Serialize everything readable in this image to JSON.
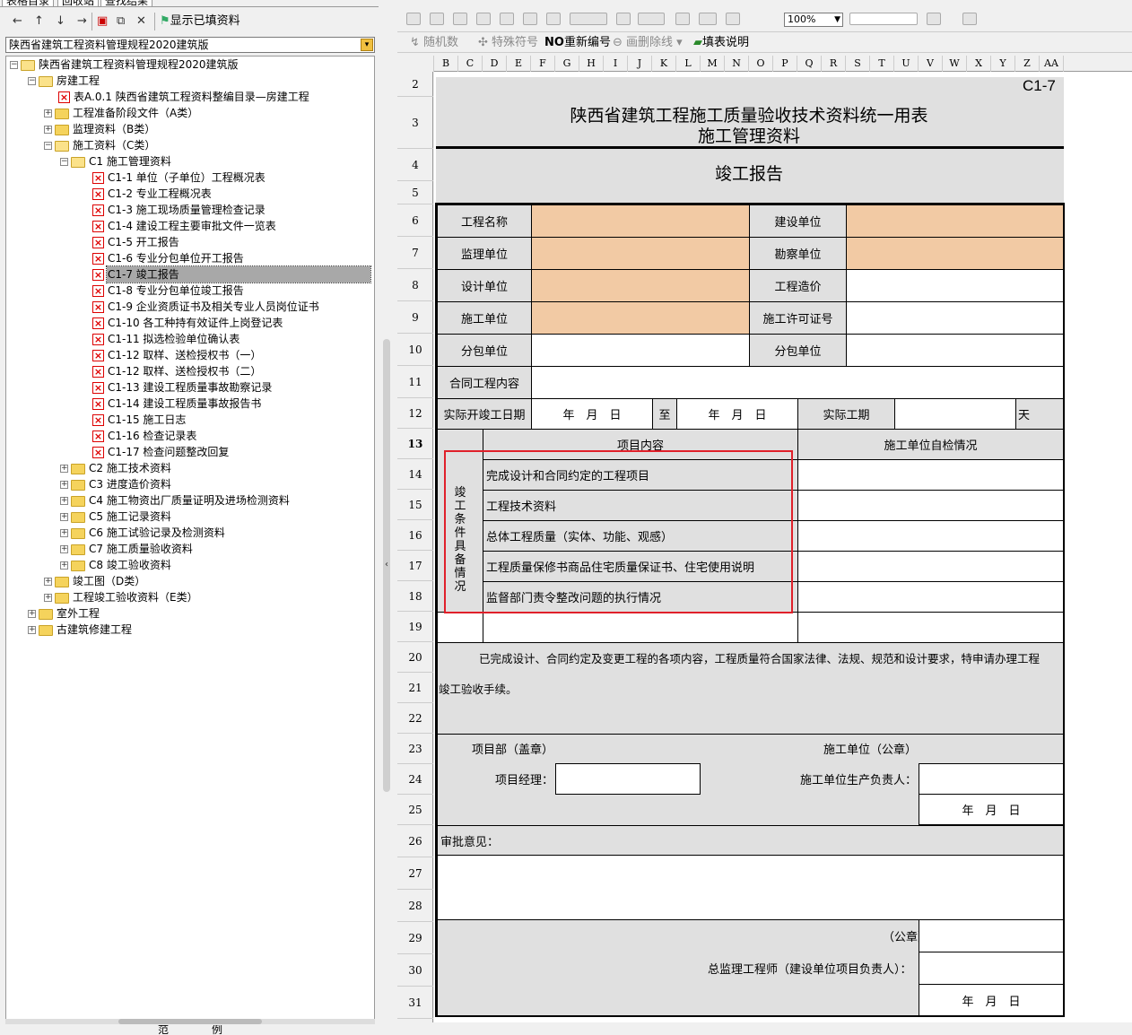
{
  "left_panel": {
    "tabs": [
      "表格目录",
      "回收站",
      "查找结果"
    ],
    "toolbar": {
      "show_filled": "显示已填资料"
    },
    "spec_select": "陕西省建筑工程资料管理规程2020建筑版",
    "tree": [
      {
        "label": "陕西省建筑工程资料管理规程2020建筑版"
      },
      {
        "label": "房建工程"
      },
      {
        "label": "表A.0.1 陕西省建筑工程资料整编目录—房建工程"
      },
      {
        "label": "工程准备阶段文件（A类）"
      },
      {
        "label": "监理资料（B类）"
      },
      {
        "label": "施工资料（C类）"
      },
      {
        "label": "C1 施工管理资料"
      },
      {
        "label": "C1-1 单位（子单位）工程概况表"
      },
      {
        "label": "C1-2 专业工程概况表"
      },
      {
        "label": "C1-3 施工现场质量管理检查记录"
      },
      {
        "label": "C1-4 建设工程主要审批文件一览表"
      },
      {
        "label": "C1-5 开工报告"
      },
      {
        "label": "C1-6 专业分包单位开工报告"
      },
      {
        "label": "C1-7 竣工报告"
      },
      {
        "label": "C1-8 专业分包单位竣工报告"
      },
      {
        "label": "C1-9 企业资质证书及相关专业人员岗位证书"
      },
      {
        "label": "C1-10 各工种持有效证件上岗登记表"
      },
      {
        "label": "C1-11 拟选检验单位确认表"
      },
      {
        "label": "C1-12 取样、送检授权书（一）"
      },
      {
        "label": "C1-12 取样、送检授权书（二）"
      },
      {
        "label": "C1-13 建设工程质量事故勘察记录"
      },
      {
        "label": "C1-14 建设工程质量事故报告书"
      },
      {
        "label": "C1-15 施工日志"
      },
      {
        "label": "C1-16 检查记录表"
      },
      {
        "label": "C1-17 检查问题整改回复"
      },
      {
        "label": "C2 施工技术资料"
      },
      {
        "label": "C3 进度造价资料"
      },
      {
        "label": "C4 施工物资出厂质量证明及进场检测资料"
      },
      {
        "label": "C5 施工记录资料"
      },
      {
        "label": "C6 施工试验记录及检测资料"
      },
      {
        "label": "C7 施工质量验收资料"
      },
      {
        "label": "C8 竣工验收资料"
      },
      {
        "label": "竣工图（D类）"
      },
      {
        "label": "工程竣工验收资料（E类）"
      },
      {
        "label": "室外工程"
      },
      {
        "label": "古建筑修建工程"
      }
    ],
    "bottom_tabs": [
      "范",
      "例"
    ]
  },
  "toolbar": {
    "zoom": "100%",
    "sigma": "Σ",
    "random_count": "随机数",
    "special_symbol": "特殊符号",
    "renumber_prefix": "NO",
    "renumber": "重新编号",
    "delete_line": "画删除线",
    "fill_help": "填表说明"
  },
  "sheet": {
    "columns": [
      "B",
      "C",
      "D",
      "E",
      "F",
      "G",
      "H",
      "I",
      "J",
      "K",
      "L",
      "M",
      "N",
      "O",
      "P",
      "Q",
      "R",
      "S",
      "T",
      "U",
      "V",
      "W",
      "X",
      "Y",
      "Z",
      "AA"
    ],
    "rows": [
      "2",
      "3",
      "4",
      "5",
      "6",
      "7",
      "8",
      "9",
      "10",
      "11",
      "12",
      "13",
      "14",
      "15",
      "16",
      "17",
      "18",
      "19",
      "20",
      "21",
      "22",
      "23",
      "24",
      "25",
      "26",
      "27",
      "28",
      "29",
      "30",
      "31"
    ],
    "form_code": "C1-7",
    "title_line1": "陕西省建筑工程施工质量验收技术资料统一用表",
    "title_line2": "施工管理资料",
    "report_title": "竣工报告",
    "labels": {
      "project_name": "工程名称",
      "construction_unit": "建设单位",
      "supervision_unit": "监理单位",
      "survey_unit": "勘察单位",
      "design_unit": "设计单位",
      "project_cost": "工程造价",
      "builder_unit": "施工单位",
      "permit_no": "施工许可证号",
      "sub_unit_1": "分包单位",
      "sub_unit_2": "分包单位",
      "contract_content": "合同工程内容",
      "actual_dates": "实际开竣工日期",
      "date_start": "年　月　日",
      "to": "至",
      "date_end": "年　月　日",
      "actual_period": "实际工期",
      "day": "天",
      "items_header": "项目内容",
      "self_check_header": "施工单位自检情况",
      "side_label": "竣工条件具备情况",
      "item1": "完成设计和合同约定的工程项目",
      "item2": "工程技术资料",
      "item3": "总体工程质量（实体、功能、观感）",
      "item4": "工程质量保修书商品住宅质量保证书、住宅使用说明",
      "item5": "监督部门责令整改问题的执行情况",
      "statement1": "已完成设计、合同约定及变更工程的各项内容，工程质量符合国家法律、法规、规范和设计要求，特申请办理工程",
      "statement2": "竣工验收手续。",
      "project_dept_seal": "项目部（盖章）",
      "builder_seal": "施工单位（公章）",
      "project_manager": "项目经理：",
      "production_head": "施工单位生产负责人：",
      "date_sign": "年　月　日",
      "approval": "审批意见：",
      "official_seal": "（公章）",
      "chief_supervisor": "总监理工程师（建设单位项目负责人）：",
      "date_sign2": "年　月　日"
    }
  }
}
